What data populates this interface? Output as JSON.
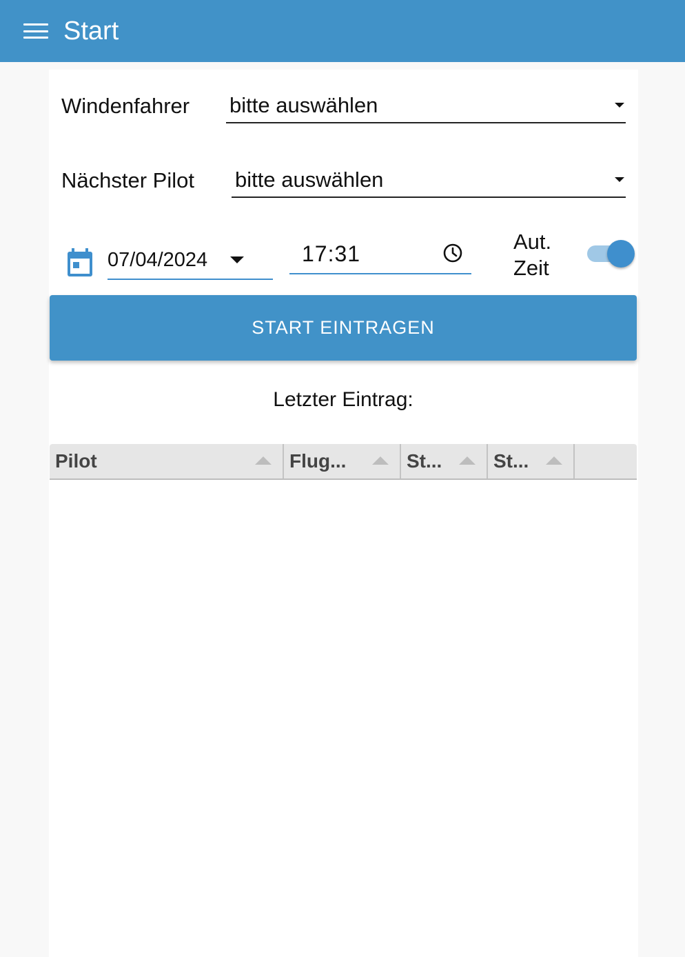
{
  "app_bar": {
    "title": "Start",
    "menu_icon": "menu-icon"
  },
  "form": {
    "winch_driver": {
      "label": "Windenfahrer",
      "value": "bitte auswählen"
    },
    "next_pilot": {
      "label": "Nächster Pilot",
      "value": "bitte auswählen"
    },
    "date": {
      "value": "07/04/2024",
      "icon": "calendar-icon"
    },
    "time": {
      "value": "17:31",
      "icon": "clock-icon"
    },
    "auto_time": {
      "label_line1": "Aut.",
      "label_line2": "Zeit",
      "checked": true
    }
  },
  "start_button": {
    "label": "START EINTRAGEN"
  },
  "last_entry": {
    "label": "Letzter Eintrag:",
    "columns": [
      "Pilot",
      "Flug...",
      "St...",
      "St..."
    ]
  },
  "colors": {
    "primary": "#4192c8",
    "accent": "#3f8fcd"
  }
}
